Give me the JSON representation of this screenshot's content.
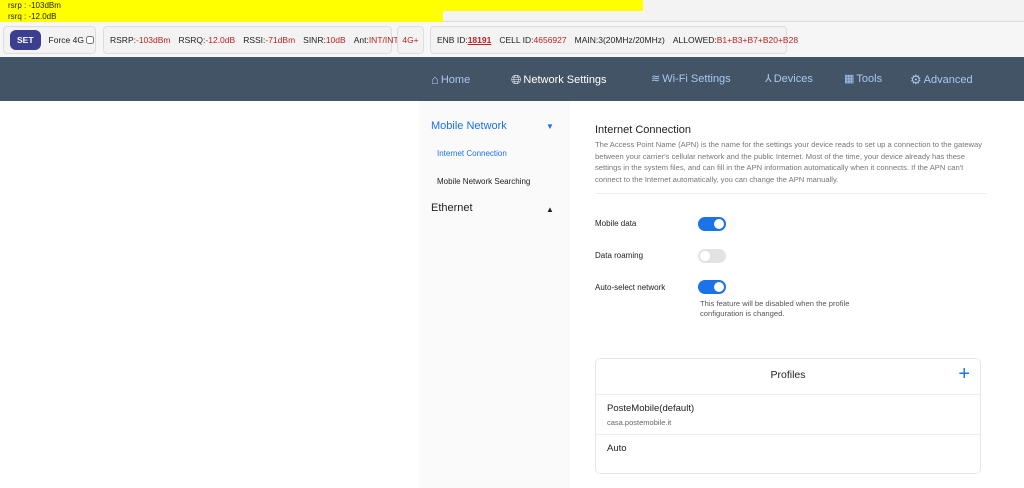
{
  "signal_bars": {
    "rsrp": "rsrp : -103dBm",
    "rsrq": "rsrq : -12.0dB"
  },
  "status": {
    "set_label": "SET",
    "force4g_label": "Force 4G",
    "rsrp_label": "RSRP:",
    "rsrp": "-103dBm",
    "rsrq_label": "RSRQ:",
    "rsrq": "-12.0dB",
    "rssi_label": "RSSI:",
    "rssi": "-71dBm",
    "sinr_label": "SINR:",
    "sinr": "10dB",
    "ant_label": "Ant:",
    "ant": "INT/INT",
    "network_type": "4G+",
    "enb_label": "ENB ID:",
    "enb": "18191",
    "cell_label": "CELL ID:",
    "cell": "4656927",
    "main": "MAIN:3(20MHz/20MHz)",
    "allowed_label": "ALLOWED:",
    "allowed": "B1+B3+B7+B20+B28"
  },
  "nav": {
    "home": "Home",
    "network": "Network Settings",
    "wifi": "Wi-Fi Settings",
    "devices": "Devices",
    "tools": "Tools",
    "advanced": "Advanced"
  },
  "sidebar": {
    "mobile_network": "Mobile Network",
    "internet_connection": "Internet Connection",
    "network_searching": "Mobile Network Searching",
    "ethernet": "Ethernet"
  },
  "main": {
    "title": "Internet Connection",
    "description": "The Access Point Name (APN) is the name for the settings your device reads to set up a connection to the gateway between your carrier's cellular network and the public Internet. Most of the time, your device already has these settings in the system files, and can fill in the APN information automatically when it connects. If the APN can't connect to the Internet automatically, you can change the APN manually.",
    "mobile_data": "Mobile data",
    "data_roaming": "Data roaming",
    "auto_select": "Auto-select network",
    "auto_note": "This feature will be disabled when the profile configuration is changed.",
    "profiles_title": "Profiles",
    "profiles": [
      {
        "name": "PosteMobile(default)",
        "apn": "casa.postemobile.it"
      },
      {
        "name": "Auto",
        "apn": ""
      }
    ]
  },
  "colors": {
    "accent": "#1a73e8",
    "nav": "#435466",
    "highlight": "#ffff00"
  }
}
